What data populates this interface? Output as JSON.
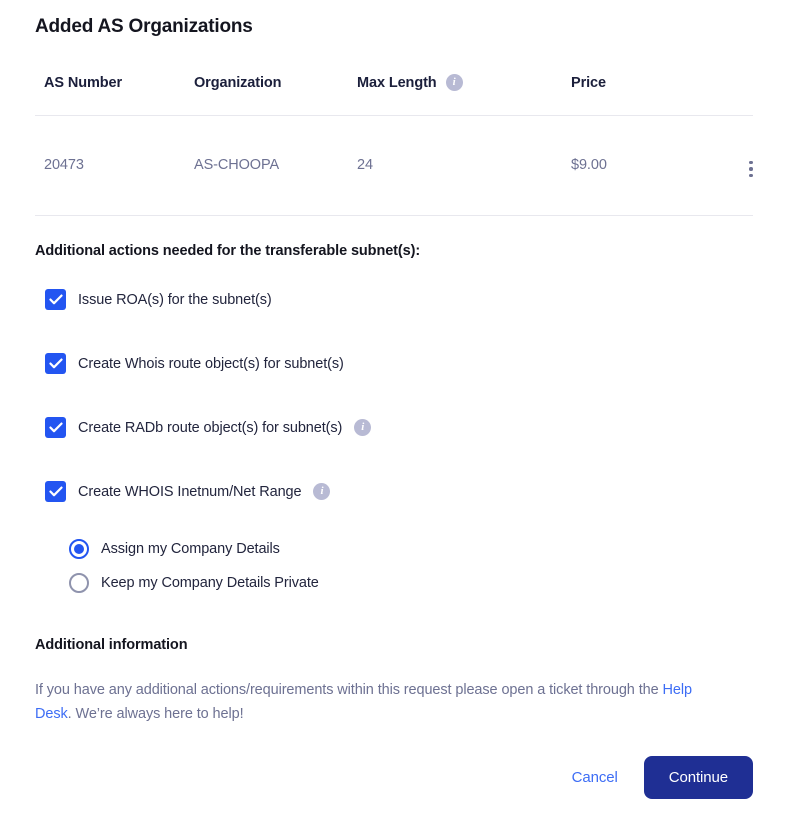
{
  "page": {
    "title": "Added AS Organizations"
  },
  "table": {
    "columns": [
      {
        "label": "AS Number",
        "info": false
      },
      {
        "label": "Organization",
        "info": false
      },
      {
        "label": "Max Length",
        "info": true,
        "info_icon": "info-icon"
      },
      {
        "label": "Price",
        "info": false
      }
    ],
    "rows": [
      {
        "as_number": "20473",
        "organization": "AS-CHOOPA",
        "max_length": "24",
        "price": "$9.00",
        "menu_icon": "kebab-menu-icon"
      }
    ]
  },
  "additional_actions": {
    "heading": "Additional actions needed for the transferable subnet(s):",
    "checkboxes": [
      {
        "label": "Issue ROA(s) for the subnet(s)",
        "checked": true,
        "info": false
      },
      {
        "label": "Create Whois route object(s) for subnet(s)",
        "checked": true,
        "info": false
      },
      {
        "label": "Create RADb route object(s) for subnet(s)",
        "checked": true,
        "info": true
      },
      {
        "label": "Create WHOIS Inetnum/Net Range",
        "checked": true,
        "info": true
      }
    ],
    "radios": [
      {
        "label": "Assign my Company Details",
        "selected": true
      },
      {
        "label": "Keep my Company Details Private",
        "selected": false
      }
    ]
  },
  "additional_information": {
    "heading": "Additional information",
    "text_before_link": "If you have any additional actions/requirements within this request please open a ticket through the ",
    "link_text": "Help Desk",
    "text_after_link": ". We’re always here to help!"
  },
  "footer": {
    "cancel_label": "Cancel",
    "continue_label": "Continue"
  },
  "colors": {
    "accent_blue": "#2355f1",
    "link_blue": "#3d6df5",
    "primary_button": "#1f2f94",
    "muted_text": "#6d7192",
    "heading_text": "#14151f",
    "info_icon_bg": "#b8bad4",
    "divider": "#e8e8ee"
  }
}
